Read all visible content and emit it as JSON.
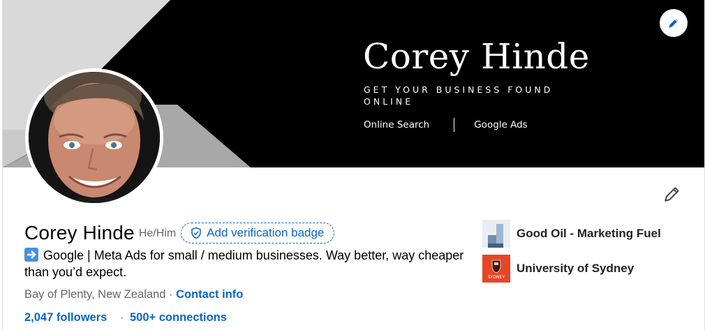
{
  "banner": {
    "title": "Corey Hinde",
    "tagline": "GET YOUR BUSINESS FOUND ONLINE",
    "links": [
      "Online Search",
      "Google Ads"
    ]
  },
  "profile": {
    "name": "Corey Hinde",
    "pronouns": "He/Him",
    "verification_label": "Add verification badge",
    "headline": "Google | Meta Ads for small / medium businesses. Way better, way cheaper than you’d expect.",
    "location": "Bay of Plenty, New Zealand",
    "location_separator": "·",
    "contact_info_label": "Contact info",
    "followers_label": "2,047 followers",
    "connections_separator": "·",
    "connections_label": "500+ connections"
  },
  "organizations": [
    {
      "name": "Good Oil - Marketing Fuel",
      "icon": "good-oil-logo"
    },
    {
      "name": "University of Sydney",
      "icon": "university-of-sydney-logo",
      "logo_text": "SYDNEY"
    }
  ],
  "icons": {
    "edit_banner": "pencil-icon",
    "edit_intro": "pencil-icon",
    "verify": "shield-check-icon",
    "headline_prefix": "right-arrow-emoji-icon"
  },
  "colors": {
    "link_blue": "#0a66c2",
    "banner_black": "#000000",
    "muted_gray": "#666666"
  }
}
